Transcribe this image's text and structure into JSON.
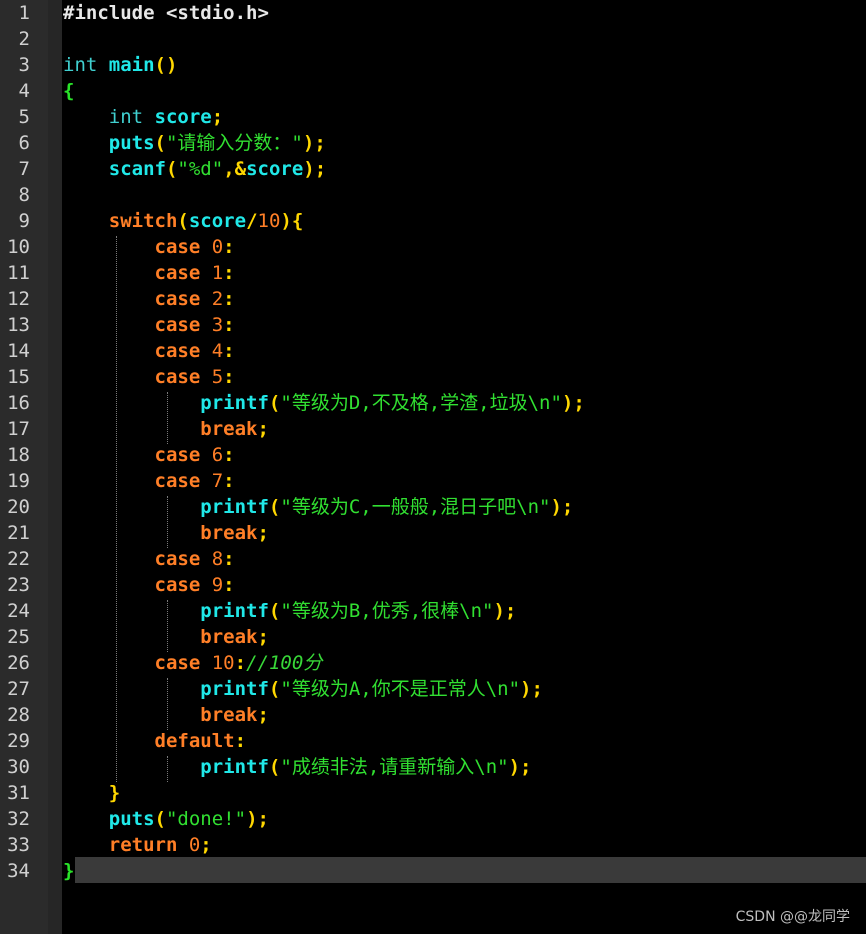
{
  "editor": {
    "line_numbers": [
      "1",
      "2",
      "3",
      "4",
      "5",
      "6",
      "7",
      "8",
      "9",
      "10",
      "11",
      "12",
      "13",
      "14",
      "15",
      "16",
      "17",
      "18",
      "19",
      "20",
      "21",
      "22",
      "23",
      "24",
      "25",
      "26",
      "27",
      "28",
      "29",
      "30",
      "31",
      "32",
      "33",
      "34"
    ],
    "current_line": "34",
    "lines": [
      {
        "indent": "",
        "tokens": [
          {
            "c": "pp",
            "t": "#include "
          },
          {
            "c": "pp",
            "t": "<stdio.h>"
          }
        ]
      },
      {
        "indent": "",
        "tokens": []
      },
      {
        "indent": "",
        "tokens": [
          {
            "c": "ty",
            "t": "int "
          },
          {
            "c": "fn",
            "t": "main"
          },
          {
            "c": "br",
            "t": "()"
          }
        ]
      },
      {
        "indent": "",
        "tokens": [
          {
            "c": "brg",
            "t": "{"
          }
        ]
      },
      {
        "indent": "    ",
        "tokens": [
          {
            "c": "ty",
            "t": "int "
          },
          {
            "c": "id",
            "t": "score"
          },
          {
            "c": "op",
            "t": ";"
          }
        ]
      },
      {
        "indent": "    ",
        "tokens": [
          {
            "c": "fn",
            "t": "puts"
          },
          {
            "c": "br",
            "t": "("
          },
          {
            "c": "str",
            "t": "\"请输入分数：\""
          },
          {
            "c": "br",
            "t": ")"
          },
          {
            "c": "op",
            "t": ";"
          }
        ]
      },
      {
        "indent": "    ",
        "tokens": [
          {
            "c": "fn",
            "t": "scanf"
          },
          {
            "c": "br",
            "t": "("
          },
          {
            "c": "str",
            "t": "\"%d\""
          },
          {
            "c": "op",
            "t": ",&"
          },
          {
            "c": "id",
            "t": "score"
          },
          {
            "c": "br",
            "t": ")"
          },
          {
            "c": "op",
            "t": ";"
          }
        ]
      },
      {
        "indent": "",
        "tokens": []
      },
      {
        "indent": "    ",
        "tokens": [
          {
            "c": "kw",
            "t": "switch"
          },
          {
            "c": "br",
            "t": "("
          },
          {
            "c": "id",
            "t": "score"
          },
          {
            "c": "op",
            "t": "/"
          },
          {
            "c": "num",
            "t": "10"
          },
          {
            "c": "br",
            "t": ")"
          },
          {
            "c": "br",
            "t": "{"
          }
        ]
      },
      {
        "indent": "        ",
        "tokens": [
          {
            "c": "kw",
            "t": "case "
          },
          {
            "c": "num",
            "t": "0"
          },
          {
            "c": "op",
            "t": ":"
          }
        ]
      },
      {
        "indent": "        ",
        "tokens": [
          {
            "c": "kw",
            "t": "case "
          },
          {
            "c": "num",
            "t": "1"
          },
          {
            "c": "op",
            "t": ":"
          }
        ]
      },
      {
        "indent": "        ",
        "tokens": [
          {
            "c": "kw",
            "t": "case "
          },
          {
            "c": "num",
            "t": "2"
          },
          {
            "c": "op",
            "t": ":"
          }
        ]
      },
      {
        "indent": "        ",
        "tokens": [
          {
            "c": "kw",
            "t": "case "
          },
          {
            "c": "num",
            "t": "3"
          },
          {
            "c": "op",
            "t": ":"
          }
        ]
      },
      {
        "indent": "        ",
        "tokens": [
          {
            "c": "kw",
            "t": "case "
          },
          {
            "c": "num",
            "t": "4"
          },
          {
            "c": "op",
            "t": ":"
          }
        ]
      },
      {
        "indent": "        ",
        "tokens": [
          {
            "c": "kw",
            "t": "case "
          },
          {
            "c": "num",
            "t": "5"
          },
          {
            "c": "op",
            "t": ":"
          }
        ]
      },
      {
        "indent": "            ",
        "tokens": [
          {
            "c": "fn",
            "t": "printf"
          },
          {
            "c": "br",
            "t": "("
          },
          {
            "c": "str",
            "t": "\"等级为D,不及格,学渣,垃圾\\n\""
          },
          {
            "c": "br",
            "t": ")"
          },
          {
            "c": "op",
            "t": ";"
          }
        ]
      },
      {
        "indent": "            ",
        "tokens": [
          {
            "c": "kw",
            "t": "break"
          },
          {
            "c": "op",
            "t": ";"
          }
        ]
      },
      {
        "indent": "        ",
        "tokens": [
          {
            "c": "kw",
            "t": "case "
          },
          {
            "c": "num",
            "t": "6"
          },
          {
            "c": "op",
            "t": ":"
          }
        ]
      },
      {
        "indent": "        ",
        "tokens": [
          {
            "c": "kw",
            "t": "case "
          },
          {
            "c": "num",
            "t": "7"
          },
          {
            "c": "op",
            "t": ":"
          }
        ]
      },
      {
        "indent": "            ",
        "tokens": [
          {
            "c": "fn",
            "t": "printf"
          },
          {
            "c": "br",
            "t": "("
          },
          {
            "c": "str",
            "t": "\"等级为C,一般般,混日子吧\\n\""
          },
          {
            "c": "br",
            "t": ")"
          },
          {
            "c": "op",
            "t": ";"
          }
        ]
      },
      {
        "indent": "            ",
        "tokens": [
          {
            "c": "kw",
            "t": "break"
          },
          {
            "c": "op",
            "t": ";"
          }
        ]
      },
      {
        "indent": "        ",
        "tokens": [
          {
            "c": "kw",
            "t": "case "
          },
          {
            "c": "num",
            "t": "8"
          },
          {
            "c": "op",
            "t": ":"
          }
        ]
      },
      {
        "indent": "        ",
        "tokens": [
          {
            "c": "kw",
            "t": "case "
          },
          {
            "c": "num",
            "t": "9"
          },
          {
            "c": "op",
            "t": ":"
          }
        ]
      },
      {
        "indent": "            ",
        "tokens": [
          {
            "c": "fn",
            "t": "printf"
          },
          {
            "c": "br",
            "t": "("
          },
          {
            "c": "str",
            "t": "\"等级为B,优秀,很棒\\n\""
          },
          {
            "c": "br",
            "t": ")"
          },
          {
            "c": "op",
            "t": ";"
          }
        ]
      },
      {
        "indent": "            ",
        "tokens": [
          {
            "c": "kw",
            "t": "break"
          },
          {
            "c": "op",
            "t": ";"
          }
        ]
      },
      {
        "indent": "        ",
        "tokens": [
          {
            "c": "kw",
            "t": "case "
          },
          {
            "c": "num",
            "t": "10"
          },
          {
            "c": "op",
            "t": ":"
          },
          {
            "c": "cm",
            "t": "//100分"
          }
        ]
      },
      {
        "indent": "            ",
        "tokens": [
          {
            "c": "fn",
            "t": "printf"
          },
          {
            "c": "br",
            "t": "("
          },
          {
            "c": "str",
            "t": "\"等级为A,你不是正常人\\n\""
          },
          {
            "c": "br",
            "t": ")"
          },
          {
            "c": "op",
            "t": ";"
          }
        ]
      },
      {
        "indent": "            ",
        "tokens": [
          {
            "c": "kw",
            "t": "break"
          },
          {
            "c": "op",
            "t": ";"
          }
        ]
      },
      {
        "indent": "        ",
        "tokens": [
          {
            "c": "kw",
            "t": "default"
          },
          {
            "c": "op",
            "t": ":"
          }
        ]
      },
      {
        "indent": "            ",
        "tokens": [
          {
            "c": "fn",
            "t": "printf"
          },
          {
            "c": "br",
            "t": "("
          },
          {
            "c": "str",
            "t": "\"成绩非法,请重新输入\\n\""
          },
          {
            "c": "br",
            "t": ")"
          },
          {
            "c": "op",
            "t": ";"
          }
        ]
      },
      {
        "indent": "    ",
        "tokens": [
          {
            "c": "br",
            "t": "}"
          }
        ]
      },
      {
        "indent": "    ",
        "tokens": [
          {
            "c": "fn",
            "t": "puts"
          },
          {
            "c": "br",
            "t": "("
          },
          {
            "c": "str",
            "t": "\"done!\""
          },
          {
            "c": "br",
            "t": ")"
          },
          {
            "c": "op",
            "t": ";"
          }
        ]
      },
      {
        "indent": "    ",
        "tokens": [
          {
            "c": "kw",
            "t": "return "
          },
          {
            "c": "num",
            "t": "0"
          },
          {
            "c": "op",
            "t": ";"
          }
        ]
      },
      {
        "indent": "",
        "tokens": [
          {
            "c": "brg",
            "t": "}"
          }
        ]
      }
    ]
  },
  "watermark": "CSDN @@龙同学",
  "colors": {
    "background": "#000000",
    "gutter": "#2b2b2b",
    "keyword": "#ff7f27",
    "function": "#20e8e8",
    "string": "#31df31",
    "bracket": "#ffd700",
    "current_line": "#3a3a3a"
  }
}
